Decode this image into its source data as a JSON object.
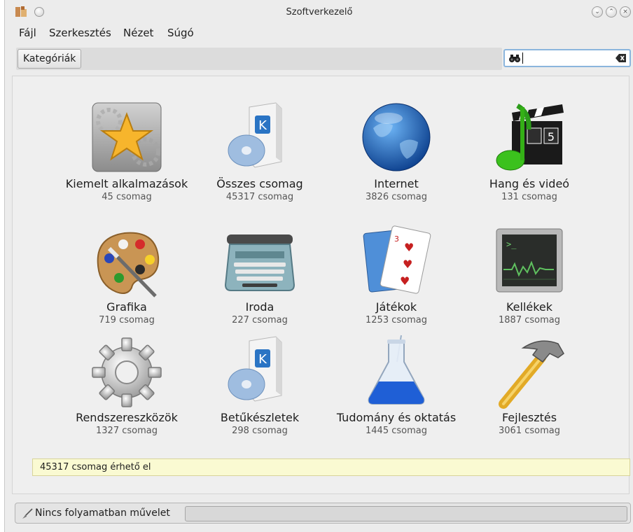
{
  "window": {
    "title": "Szoftverkezelő",
    "controls": {
      "minimize": "⌄",
      "maximize": "⌃",
      "close": "×"
    }
  },
  "menubar": [
    {
      "label": "Fájl"
    },
    {
      "label": "Szerkesztés"
    },
    {
      "label": "Nézet"
    },
    {
      "label": "Súgó"
    }
  ],
  "toolbar": {
    "categories_button": "Kategóriák",
    "search_value": "",
    "search_placeholder": ""
  },
  "categories": [
    {
      "name": "Kiemelt alkalmazások",
      "count": "45 csomag",
      "icon": "featured-star-icon"
    },
    {
      "name": "Összes csomag",
      "count": "45317 csomag",
      "icon": "package-box-icon"
    },
    {
      "name": "Internet",
      "count": "3826 csomag",
      "icon": "globe-icon"
    },
    {
      "name": "Hang és videó",
      "count": "131 csomag",
      "icon": "clapperboard-icon"
    },
    {
      "name": "Grafika",
      "count": "719 csomag",
      "icon": "paint-palette-icon"
    },
    {
      "name": "Iroda",
      "count": "227 csomag",
      "icon": "typewriter-icon"
    },
    {
      "name": "Játékok",
      "count": "1253 csomag",
      "icon": "playing-cards-icon"
    },
    {
      "name": "Kellékek",
      "count": "1887 csomag",
      "icon": "terminal-monitor-icon"
    },
    {
      "name": "Rendszereszközök",
      "count": "1327 csomag",
      "icon": "gear-icon"
    },
    {
      "name": "Betűkészletek",
      "count": "298 csomag",
      "icon": "package-box-icon"
    },
    {
      "name": "Tudomány és oktatás",
      "count": "1445 csomag",
      "icon": "flask-icon"
    },
    {
      "name": "Fejlesztés",
      "count": "3061 csomag",
      "icon": "hammer-icon"
    }
  ],
  "status_message": "45317 csomag érhető el",
  "statusbar": {
    "text": "Nincs folyamatban művelet",
    "progress": 0
  },
  "colors": {
    "window_bg": "#ececec",
    "status_message_bg": "#fafad2",
    "search_focus": "#8bb5dd"
  }
}
